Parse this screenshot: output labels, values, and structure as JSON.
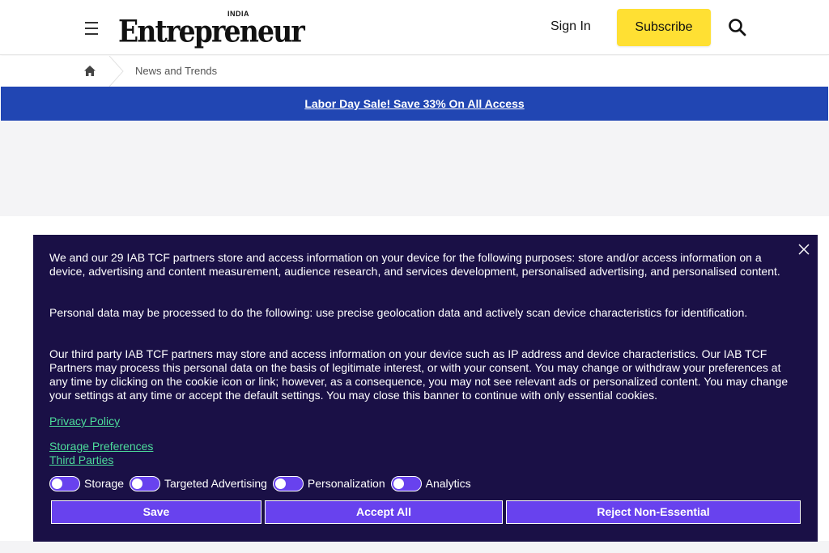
{
  "header": {
    "logo_word": "Entrepreneur",
    "logo_edition": "INDIA",
    "signin_label": "Sign In",
    "subscribe_label": "Subscribe",
    "subscribe_color": "#ffe033"
  },
  "breadcrumb": {
    "current": "News and Trends"
  },
  "promo": {
    "text": "Labor Day Sale! Save 33% On All Access",
    "color": "#2146b3"
  },
  "consent": {
    "background": "#1a1046",
    "paragraph1": "We and our 29 IAB TCF partners store and access information on your device for the following purposes: store and/or access information on a device, advertising and content measurement, audience research, and services development, personalised advertising, and personalised content.",
    "paragraph2": "Personal data may be processed to do the following: use precise geolocation data and actively scan device characteristics for identification.",
    "paragraph3": "Our third party IAB TCF partners may store and access information on your device such as IP address and device characteristics. Our IAB TCF Partners may process this personal data on the basis of legitimate interest, or with your consent. You may change or withdraw your preferences at any time by clicking on the cookie icon or link; however, as a consequence, you may not see relevant ads or personalized content. You may change your settings at any time or accept the default settings. You may close this banner to continue with only essential cookies.",
    "privacy_policy": "Privacy Policy",
    "storage_preferences": "Storage Preferences",
    "third_parties": "Third Parties",
    "toggles": [
      "Storage",
      "Targeted Advertising",
      "Personalization",
      "Analytics"
    ],
    "save_label": "Save",
    "accept_label": "Accept All",
    "reject_label": "Reject Non-Essential",
    "button_color": "#6842ee",
    "link_color": "#4ddc9b"
  }
}
